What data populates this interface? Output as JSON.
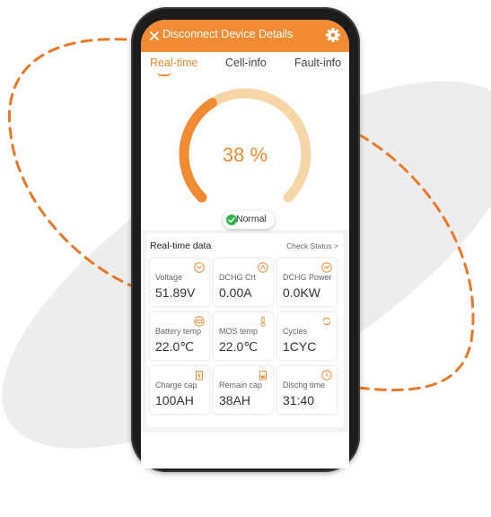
{
  "colors": {
    "accent": "#f08b33",
    "accent_light": "#f6d6a6"
  },
  "header": {
    "title": "Disconnect Device Details",
    "close_icon": "close-icon",
    "settings_icon": "gear-icon"
  },
  "tabs": [
    {
      "label": "Real-time",
      "active": true
    },
    {
      "label": "Cell-info",
      "active": false
    },
    {
      "label": "Fault-info",
      "active": false
    }
  ],
  "gauge": {
    "percent_label": "38 %",
    "level": 0.38,
    "status": "Normal"
  },
  "realtime": {
    "title": "Real-time data",
    "check_status": "Check Status >",
    "cards": [
      {
        "label": "Voltage",
        "value": "51.89V",
        "icon": "voltage-icon"
      },
      {
        "label": "DCHG Crt",
        "value": "0.00A",
        "icon": "current-icon"
      },
      {
        "label": "DCHG Power",
        "value": "0.0KW",
        "icon": "power-icon"
      },
      {
        "label": "Battery temp",
        "value": "22.0℃",
        "icon": "battery-temp-icon"
      },
      {
        "label": "MOS temp",
        "value": "22.0℃",
        "icon": "thermometer-icon"
      },
      {
        "label": "Cycles",
        "value": "1CYC",
        "icon": "cycle-icon"
      },
      {
        "label": "Charge cap",
        "value": "100AH",
        "icon": "charge-cap-icon"
      },
      {
        "label": "Remain cap",
        "value": "38AH",
        "icon": "remain-cap-icon"
      },
      {
        "label": "Dischg time",
        "value": "31:40",
        "icon": "clock-icon"
      }
    ]
  }
}
